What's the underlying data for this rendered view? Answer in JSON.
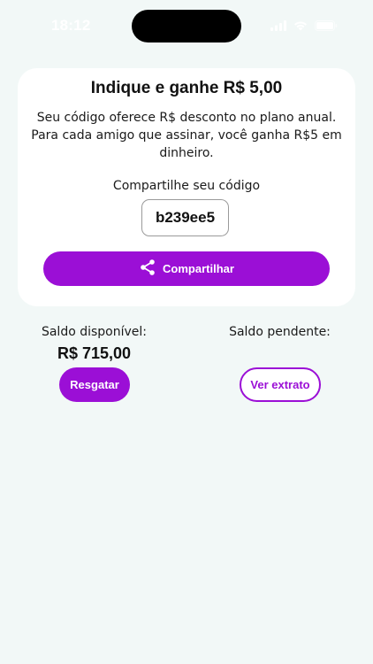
{
  "status_bar": {
    "time": "18:12",
    "icons": [
      "signal-icon",
      "wifi-icon",
      "battery-icon"
    ]
  },
  "referral_card": {
    "title": "Indique e ganhe R$ 5,00",
    "description": "Seu código oferece R$ desconto no plano anual. Para cada amigo que assinar, você ganha R$5 em dinheiro.",
    "share_caption": "Compartilhe seu código",
    "code": "b239ee5",
    "share_button_label": "Compartilhar",
    "share_icon": "share-icon"
  },
  "balances": {
    "available_label": "Saldo disponível:",
    "available_value": "R$ 715,00",
    "pending_label": "Saldo pendente:",
    "pending_value": "",
    "redeem_button_label": "Resgatar",
    "statement_button_label": "Ver extrato"
  },
  "colors": {
    "background": "#f2f8f7",
    "card": "#ffffff",
    "accent": "#9b0fd6",
    "text": "#111111"
  }
}
